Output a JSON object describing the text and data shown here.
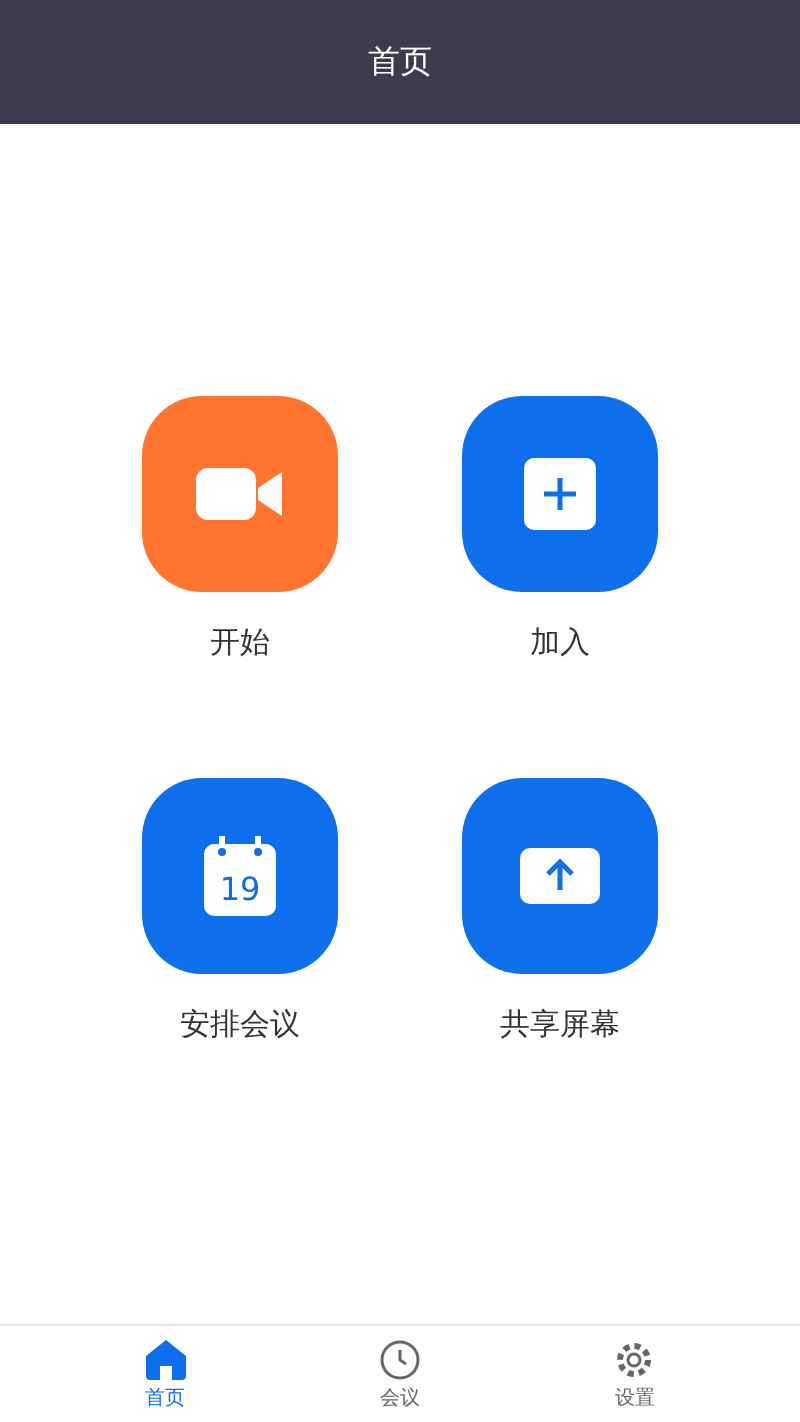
{
  "header": {
    "title": "首页"
  },
  "actions": [
    {
      "kind": "video",
      "label": "开始",
      "color": "#ff742e"
    },
    {
      "kind": "plus",
      "label": "加入",
      "color": "#0e6fec"
    },
    {
      "kind": "calendar",
      "label": "安排会议",
      "color": "#0e6fec",
      "day": "19"
    },
    {
      "kind": "share",
      "label": "共享屏幕",
      "color": "#0e6fec"
    }
  ],
  "tabs": [
    {
      "kind": "home",
      "label": "首页",
      "selected": true
    },
    {
      "kind": "clock",
      "label": "会议",
      "selected": false
    },
    {
      "kind": "gear",
      "label": "设置",
      "selected": false
    }
  ]
}
